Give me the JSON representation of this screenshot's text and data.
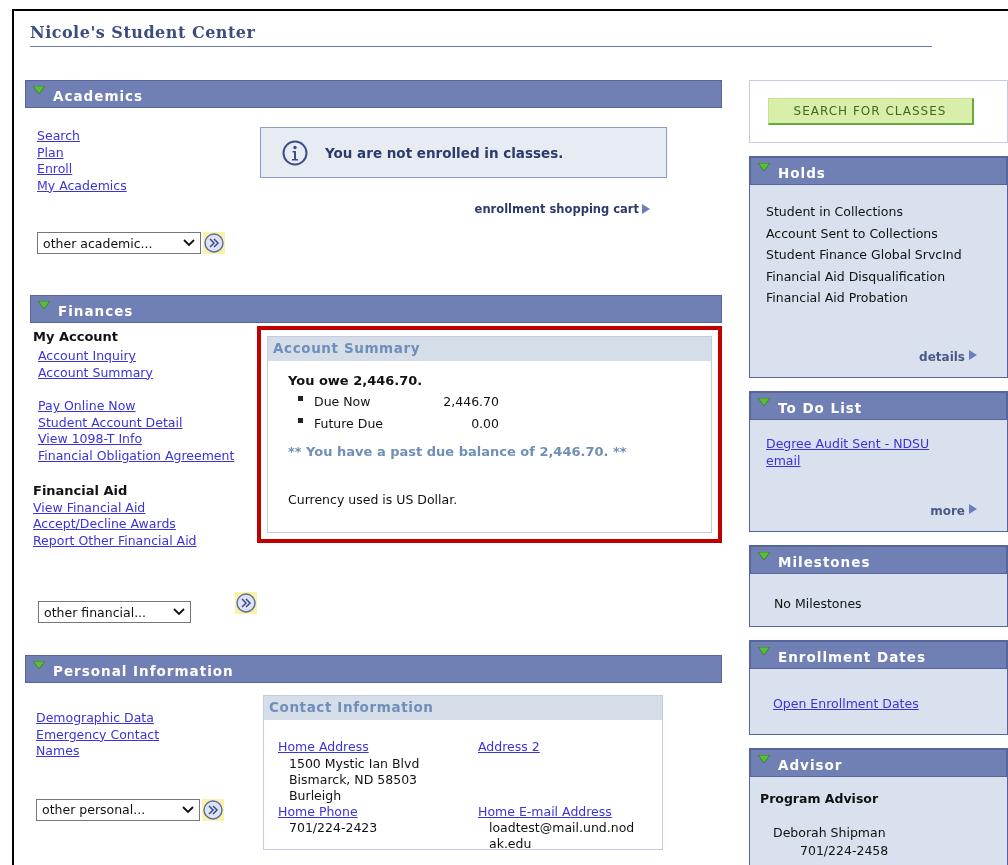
{
  "page_title": "Nicole's Student Center",
  "academics": {
    "title": "Academics",
    "links": [
      "Search",
      "Plan",
      "Enroll",
      "My Academics"
    ],
    "notice": "You are not enrolled in classes.",
    "cart_link": "enrollment shopping cart",
    "dropdown": "other academic..."
  },
  "finances": {
    "title": "Finances",
    "my_account_heading": "My Account",
    "account_links": [
      "Account Inquiry",
      "Account Summary"
    ],
    "account_links_2": [
      "Pay Online Now",
      "Student Account Detail",
      "View 1098-T Info",
      "Financial Obligation Agreement"
    ],
    "financial_aid_heading": "Financial Aid",
    "aid_links": [
      "View Financial Aid",
      "Accept/Decline Awards",
      "Report Other Financial Aid"
    ],
    "dropdown": "other financial...",
    "summary": {
      "title": "Account Summary",
      "highlighted": true,
      "owe": "You owe 2,446.70.",
      "items": [
        {
          "label": "Due Now",
          "amount": "2,446.70"
        },
        {
          "label": "Future Due",
          "amount": "0.00"
        }
      ],
      "past_due": "** You have a past due balance of 2,446.70. **",
      "currency": "Currency used is US Dollar."
    }
  },
  "personal": {
    "title": "Personal Information",
    "links": [
      "Demographic Data",
      "Emergency Contact",
      "Names"
    ],
    "dropdown": "other personal...",
    "contact": {
      "title": "Contact Information",
      "home_address_link": "Home Address",
      "address_lines": [
        "1500 Mystic Ian Blvd",
        "Bismarck, ND 58503",
        "Burleigh"
      ],
      "address2_link": "Address 2",
      "home_phone_link": "Home Phone",
      "phone": "701/224-2423",
      "email_link": "Home E-mail Address",
      "email_lines": [
        "loadtest@mail.und.nod",
        "ak.edu"
      ]
    }
  },
  "search_button": "SEARCH FOR CLASSES",
  "holds": {
    "title": "Holds",
    "items": [
      "Student in Collections",
      "Account Sent to Collections",
      "Student Finance Global SrvcInd",
      "Financial Aid Disqualification",
      "Financial Aid Probation"
    ],
    "details_link": "details"
  },
  "todo": {
    "title": "To Do List",
    "items": [
      "Degree Audit Sent - NDSU email"
    ],
    "more_link": "more"
  },
  "milestones": {
    "title": "Milestones",
    "text": "No Milestones"
  },
  "enrollment_dates": {
    "title": "Enrollment Dates",
    "link": "Open Enrollment Dates"
  },
  "advisor": {
    "title": "Advisor",
    "role": "Program Advisor",
    "name": "Deborah Shipman",
    "phone": "701/224-2458"
  }
}
